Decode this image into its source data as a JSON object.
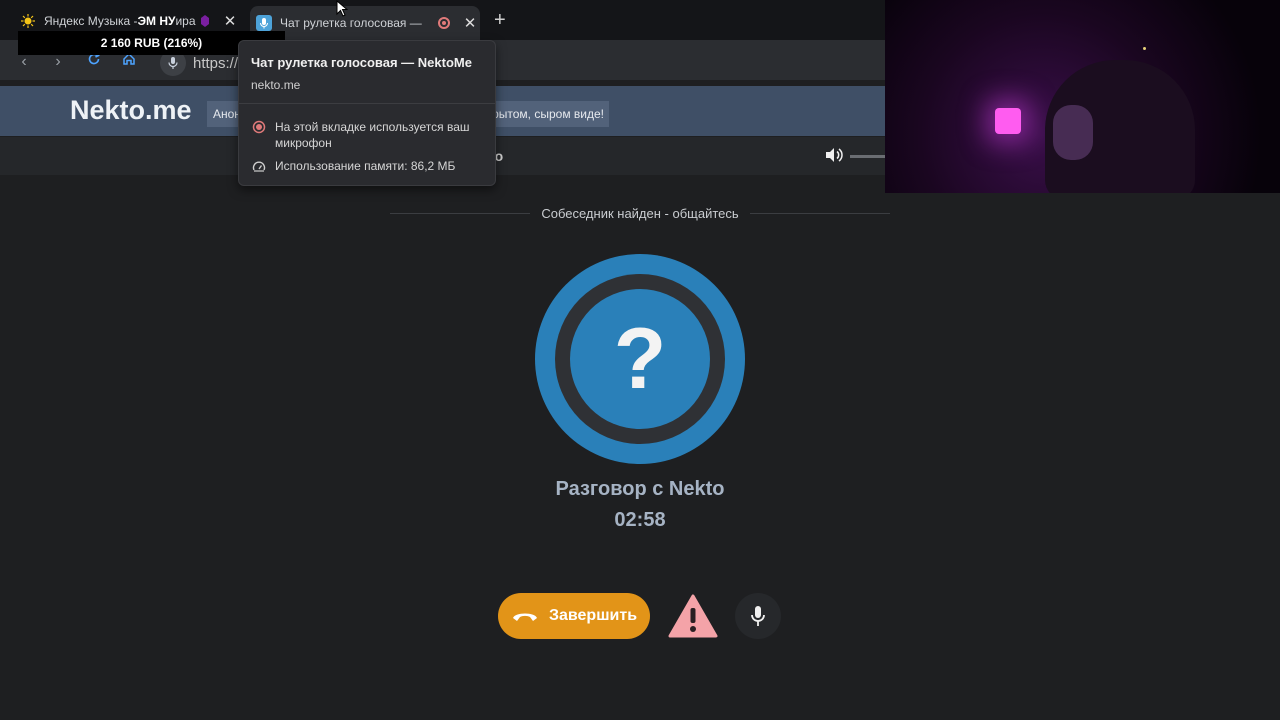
{
  "browser": {
    "tabs": [
      {
        "title": "Яндекс Музыка -",
        "overlay": "ЭМ НУ",
        "suffix": "ира",
        "close": "✕"
      },
      {
        "title": "Чат рулетка голосовая —",
        "close": "✕"
      }
    ],
    "new_tab": "+",
    "address_prefix": "https://",
    "price_badge": "2 160 RUB (216%)"
  },
  "tab_popup": {
    "title": "Чат рулетка голосовая — NektoMe",
    "host": "nekto.me",
    "mic_notice": "На этой вкладке используется ваш микрофон",
    "memory": "Использование памяти: 86,2 МБ"
  },
  "site": {
    "logo": "Nekto.me",
    "notice_left": "Анон",
    "notice_right": "крытом, сыром виде!",
    "subbar_text": "to"
  },
  "chat": {
    "status": "Собеседник найден - общайтесь",
    "avatar_symbol": "?",
    "talk_title": "Разговор с Nekto",
    "timer": "02:58",
    "end_button": "Завершить"
  },
  "colors": {
    "accent_blue": "#2a80b9",
    "end_orange": "#e29418",
    "warning_pink": "#f4a3a8"
  }
}
